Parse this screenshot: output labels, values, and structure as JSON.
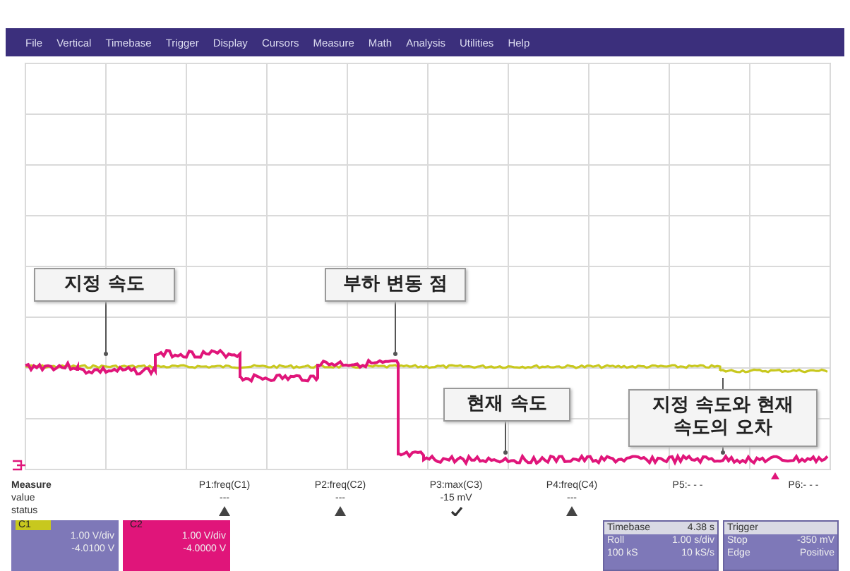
{
  "menu": [
    "File",
    "Vertical",
    "Timebase",
    "Trigger",
    "Display",
    "Cursors",
    "Measure",
    "Math",
    "Analysis",
    "Utilities",
    "Help"
  ],
  "callouts": [
    {
      "text": "지정 속도"
    },
    {
      "text": "부하 변동 점"
    },
    {
      "text": "현재 속도"
    },
    {
      "text": "지정 속도와 현재 속도의 오차"
    }
  ],
  "measure": {
    "title": "Measure",
    "row_labels": [
      "value",
      "status"
    ],
    "params": [
      {
        "name": "P1:freq(C1)",
        "value": "---",
        "kind": "warning"
      },
      {
        "name": "P2:freq(C2)",
        "value": "---",
        "kind": "warning"
      },
      {
        "name": "P3:max(C3)",
        "value": "-15 mV",
        "kind": "ok"
      },
      {
        "name": "P4:freq(C4)",
        "value": "---",
        "kind": "warning"
      },
      {
        "name": "P5:- - -"
      },
      {
        "name": "P6:- - -"
      }
    ]
  },
  "channels": [
    {
      "name": "C1",
      "color": "#c8c81e",
      "scale": "1.00 V/div",
      "offset": "-4.0100 V"
    },
    {
      "name": "C2",
      "color": "#e0157a",
      "scale": "1.00 V/div",
      "offset": "-4.0000 V"
    }
  ],
  "timebase": {
    "title": "Timebase",
    "value": "4.38 s",
    "rows": [
      [
        "Roll",
        "1.00 s/div"
      ],
      [
        "100 kS",
        "10 kS/s"
      ]
    ]
  },
  "trigger": {
    "title": "Trigger",
    "rows": [
      [
        "Stop",
        "-350 mV"
      ],
      [
        "Edge",
        "Positive"
      ]
    ]
  }
}
